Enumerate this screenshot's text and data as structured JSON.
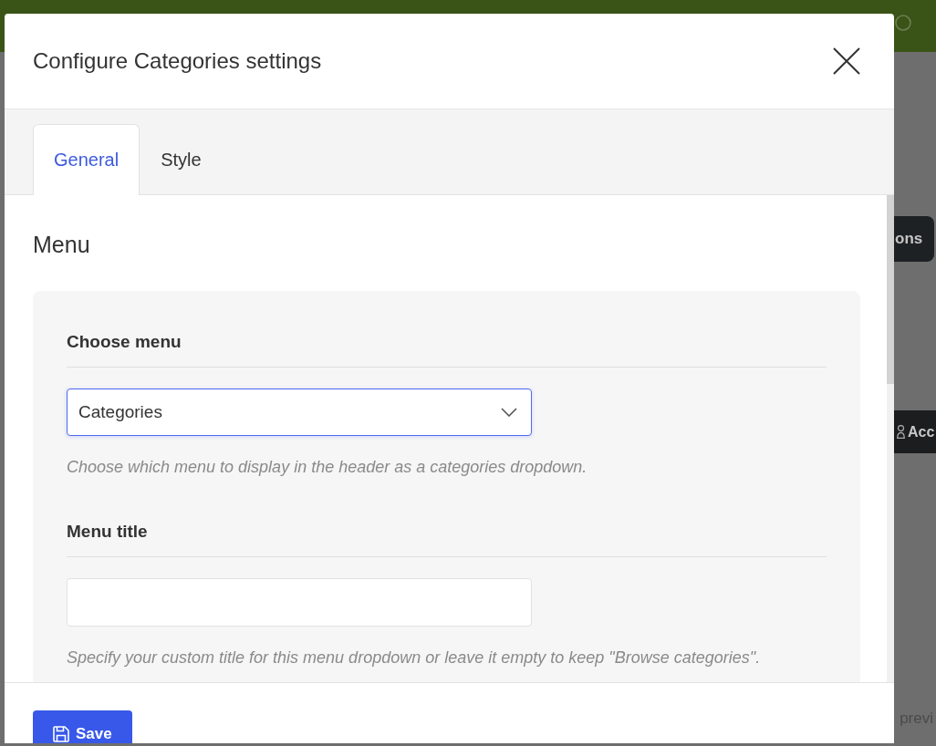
{
  "background": {
    "toolbar_button": {
      "label": "ons"
    },
    "account_bar": {
      "label": "Acc"
    },
    "footer_text": "previ"
  },
  "dialog": {
    "title": "Configure Categories settings",
    "tabs": [
      {
        "label": "General",
        "selected": true
      },
      {
        "label": "Style",
        "selected": false
      }
    ],
    "section_title": "Menu",
    "fields": [
      {
        "kind": "select",
        "label": "Choose menu",
        "value": "Categories",
        "focused": true,
        "help": "Choose which menu to display in the header as a categories dropdown."
      },
      {
        "kind": "text",
        "label": "Menu title",
        "focused": false,
        "help": "Specify your custom title for this menu dropdown or leave it empty to keep \"Browse categories\"."
      }
    ],
    "save_button": {
      "label": "Save"
    }
  }
}
